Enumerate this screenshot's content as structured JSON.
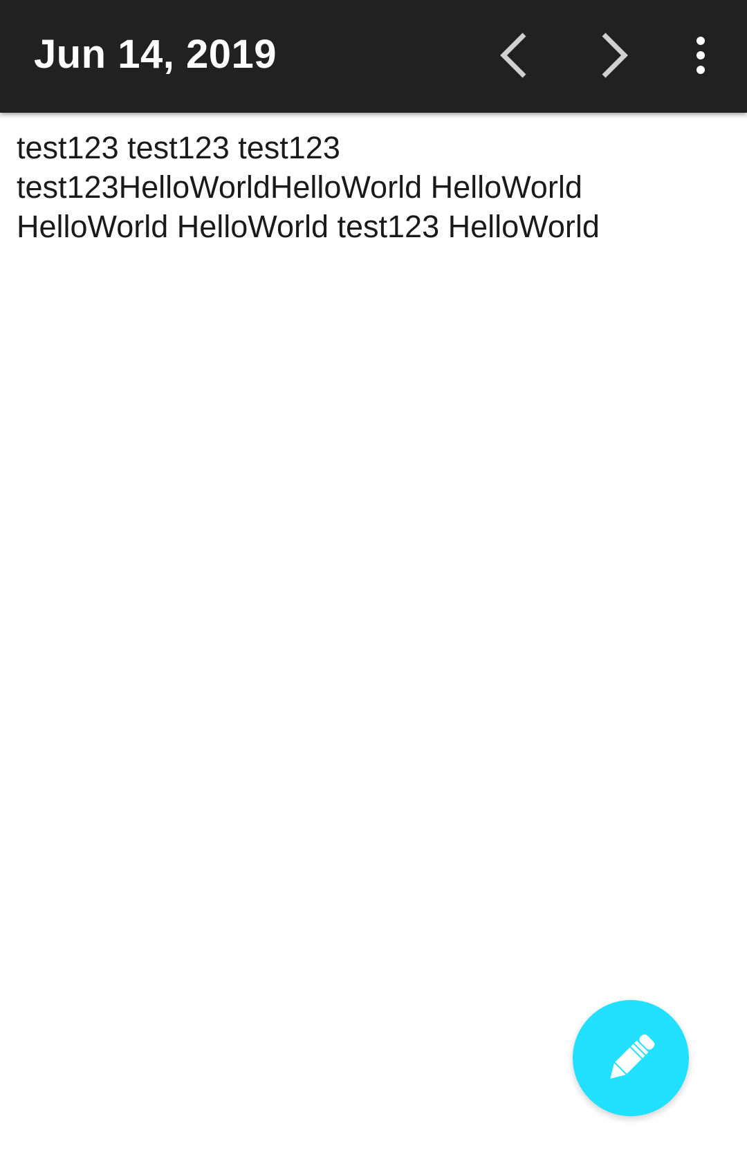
{
  "toolbar": {
    "title": "Jun 14, 2019",
    "prev_icon": "chevron-left-icon",
    "next_icon": "chevron-right-icon",
    "more_icon": "more-vert-icon",
    "background_color": "#212121"
  },
  "note": {
    "text": "test123 test123 test123\ntest123HelloWorldHelloWorld HelloWorld\nHelloWorld HelloWorld test123 HelloWorld"
  },
  "fab": {
    "icon": "pencil-icon",
    "color": "#22e0ff"
  }
}
